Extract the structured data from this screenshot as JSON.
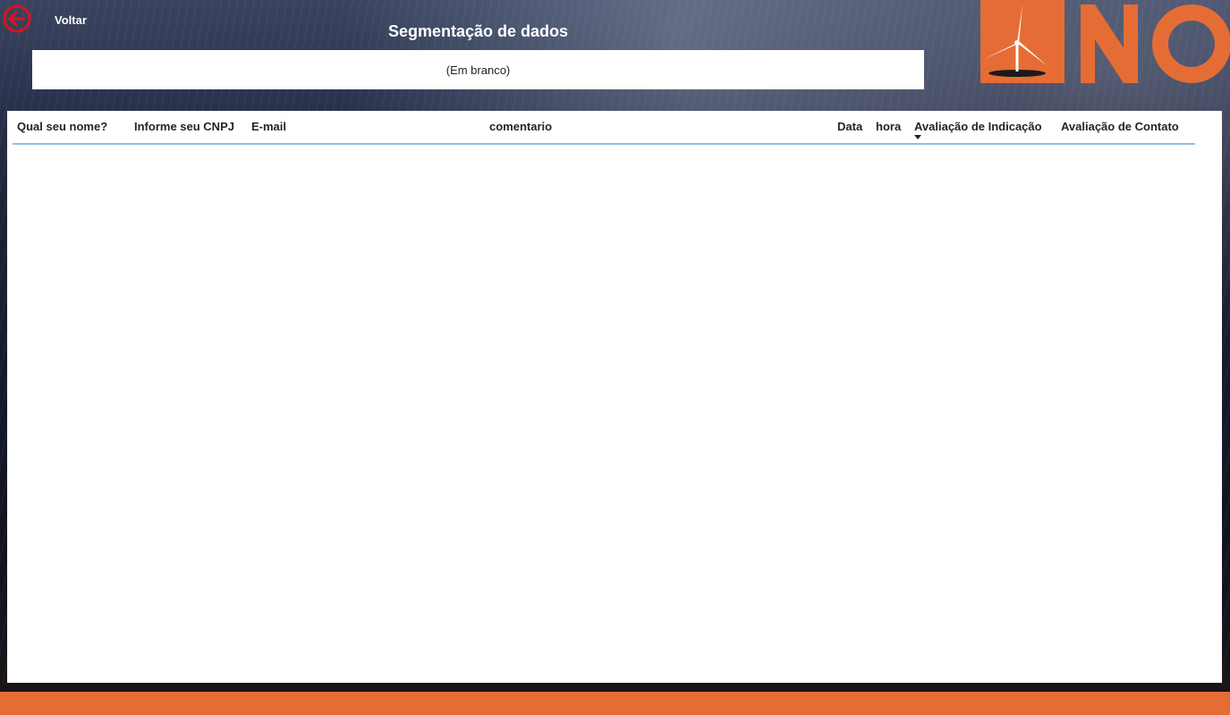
{
  "nav": {
    "back_label": "Voltar",
    "back_icon": "arrow-left-circle-icon",
    "back_color": "#e0101a"
  },
  "slicer": {
    "title": "Segmentação de dados",
    "value": "(Em branco)"
  },
  "logo": {
    "icon": "wind-turbine-icon",
    "letters": "NO",
    "brand_color": "#e56d35"
  },
  "table": {
    "columns": [
      "Qual seu nome?",
      "Informe seu CNPJ",
      "E-mail",
      "comentario",
      "Data",
      "hora",
      "Avaliação de Indicação",
      "Avaliação de Contato"
    ],
    "sorted_column": "Avaliação de Indicação",
    "sort_direction": "descending",
    "rows": []
  },
  "colors": {
    "accent_bar": "#e56d35",
    "header_underline": "#8cc0e6"
  }
}
